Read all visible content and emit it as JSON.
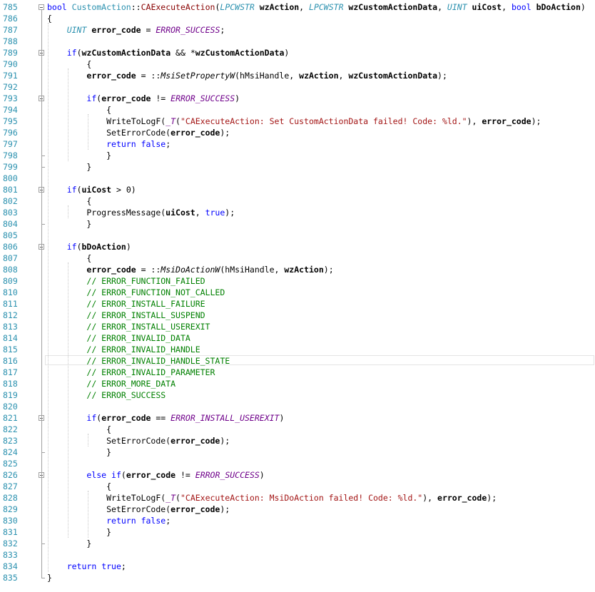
{
  "editor": {
    "lines": [
      {
        "n": "785",
        "t": [
          [
            "kw",
            "bool"
          ],
          [
            "",
            " "
          ],
          [
            "ty2",
            "CustomAction"
          ],
          [
            "",
            "::"
          ],
          [
            "fn",
            "CAExecuteAction"
          ],
          [
            "",
            "("
          ],
          [
            "ty",
            "LPCWSTR"
          ],
          [
            "",
            ""
          ],
          [
            "par",
            " wzAction"
          ],
          [
            "",
            ", "
          ],
          [
            "ty",
            "LPCWSTR"
          ],
          [
            "par",
            " wzCustomActionData"
          ],
          [
            "",
            ", "
          ],
          [
            "ty",
            "UINT"
          ],
          [
            "par",
            " uiCost"
          ],
          [
            "",
            ", "
          ],
          [
            "kw",
            "bool"
          ],
          [
            "par",
            " bDoAction"
          ],
          [
            "",
            ")"
          ]
        ]
      },
      {
        "n": "786",
        "t": [
          [
            "",
            "{"
          ]
        ]
      },
      {
        "n": "787",
        "t": [
          [
            "",
            "    "
          ],
          [
            "ty",
            "UINT"
          ],
          [
            "par",
            " error_code"
          ],
          [
            "",
            " = "
          ],
          [
            "mac",
            "ERROR_SUCCESS"
          ],
          [
            "",
            ";"
          ]
        ]
      },
      {
        "n": "788",
        "t": []
      },
      {
        "n": "789",
        "t": [
          [
            "",
            "    "
          ],
          [
            "kw",
            "if"
          ],
          [
            "",
            "("
          ],
          [
            "par",
            "wzCustomActionData"
          ],
          [
            "",
            " && *"
          ],
          [
            "par",
            "wzCustomActionData"
          ],
          [
            "",
            ")"
          ]
        ]
      },
      {
        "n": "790",
        "t": [
          [
            "",
            "        {"
          ]
        ]
      },
      {
        "n": "791",
        "t": [
          [
            "",
            "        "
          ],
          [
            "par",
            "error_code"
          ],
          [
            "",
            " = ::"
          ],
          [
            "mfn",
            "MsiSetPropertyW"
          ],
          [
            "",
            "(hMsiHandle, "
          ],
          [
            "par",
            "wzAction"
          ],
          [
            "",
            ", "
          ],
          [
            "par",
            "wzCustomActionData"
          ],
          [
            "",
            ");"
          ]
        ]
      },
      {
        "n": "792",
        "t": []
      },
      {
        "n": "793",
        "t": [
          [
            "",
            "        "
          ],
          [
            "kw",
            "if"
          ],
          [
            "",
            "("
          ],
          [
            "par",
            "error_code"
          ],
          [
            "",
            " != "
          ],
          [
            "mac",
            "ERROR_SUCCESS"
          ],
          [
            "",
            ")"
          ]
        ]
      },
      {
        "n": "794",
        "t": [
          [
            "",
            "            {"
          ]
        ]
      },
      {
        "n": "795",
        "t": [
          [
            "",
            "            WriteToLogF("
          ],
          [
            "mac",
            "_T"
          ],
          [
            "",
            "("
          ],
          [
            "str",
            "\"CAExecuteAction: Set CustomActionData failed! Code: %ld.\""
          ],
          [
            "",
            "), "
          ],
          [
            "par",
            "error_code"
          ],
          [
            "",
            ");"
          ]
        ]
      },
      {
        "n": "796",
        "t": [
          [
            "",
            "            SetErrorCode("
          ],
          [
            "par",
            "error_code"
          ],
          [
            "",
            ");"
          ]
        ]
      },
      {
        "n": "797",
        "t": [
          [
            "",
            "            "
          ],
          [
            "kw",
            "return"
          ],
          [
            "",
            " "
          ],
          [
            "kw",
            "false"
          ],
          [
            "",
            ";"
          ]
        ]
      },
      {
        "n": "798",
        "t": [
          [
            "",
            "            }"
          ]
        ]
      },
      {
        "n": "799",
        "t": [
          [
            "",
            "        }"
          ]
        ]
      },
      {
        "n": "800",
        "t": []
      },
      {
        "n": "801",
        "t": [
          [
            "",
            "    "
          ],
          [
            "kw",
            "if"
          ],
          [
            "",
            "("
          ],
          [
            "par",
            "uiCost"
          ],
          [
            "",
            " > 0)"
          ]
        ]
      },
      {
        "n": "802",
        "t": [
          [
            "",
            "        {"
          ]
        ]
      },
      {
        "n": "803",
        "t": [
          [
            "",
            "        ProgressMessage("
          ],
          [
            "par",
            "uiCost"
          ],
          [
            "",
            ", "
          ],
          [
            "kw",
            "true"
          ],
          [
            "",
            ");"
          ]
        ]
      },
      {
        "n": "804",
        "t": [
          [
            "",
            "        }"
          ]
        ]
      },
      {
        "n": "805",
        "t": []
      },
      {
        "n": "806",
        "t": [
          [
            "",
            "    "
          ],
          [
            "kw",
            "if"
          ],
          [
            "",
            "("
          ],
          [
            "par",
            "bDoAction"
          ],
          [
            "",
            ")"
          ]
        ]
      },
      {
        "n": "807",
        "t": [
          [
            "",
            "        {"
          ]
        ]
      },
      {
        "n": "808",
        "t": [
          [
            "",
            "        "
          ],
          [
            "par",
            "error_code"
          ],
          [
            "",
            " = ::"
          ],
          [
            "mfn",
            "MsiDoActionW"
          ],
          [
            "",
            "(hMsiHandle, "
          ],
          [
            "par",
            "wzAction"
          ],
          [
            "",
            ");"
          ]
        ]
      },
      {
        "n": "809",
        "t": [
          [
            "",
            "        "
          ],
          [
            "cm",
            "// ERROR_FUNCTION_FAILED"
          ]
        ]
      },
      {
        "n": "810",
        "t": [
          [
            "",
            "        "
          ],
          [
            "cm",
            "// ERROR_FUNCTION_NOT_CALLED"
          ]
        ]
      },
      {
        "n": "811",
        "t": [
          [
            "",
            "        "
          ],
          [
            "cm",
            "// ERROR_INSTALL_FAILURE"
          ]
        ]
      },
      {
        "n": "812",
        "t": [
          [
            "",
            "        "
          ],
          [
            "cm",
            "// ERROR_INSTALL_SUSPEND"
          ]
        ]
      },
      {
        "n": "813",
        "t": [
          [
            "",
            "        "
          ],
          [
            "cm",
            "// ERROR_INSTALL_USEREXIT"
          ]
        ]
      },
      {
        "n": "814",
        "t": [
          [
            "",
            "        "
          ],
          [
            "cm",
            "// ERROR_INVALID_DATA"
          ]
        ]
      },
      {
        "n": "815",
        "t": [
          [
            "",
            "        "
          ],
          [
            "cm",
            "// ERROR_INVALID_HANDLE"
          ]
        ]
      },
      {
        "n": "816",
        "t": [
          [
            "",
            "        "
          ],
          [
            "cm",
            "// ERROR_INVALID_HANDLE_STATE"
          ]
        ]
      },
      {
        "n": "817",
        "t": [
          [
            "",
            "        "
          ],
          [
            "cm",
            "// ERROR_INVALID_PARAMETER"
          ]
        ]
      },
      {
        "n": "818",
        "t": [
          [
            "",
            "        "
          ],
          [
            "cm",
            "// ERROR_MORE_DATA"
          ]
        ]
      },
      {
        "n": "819",
        "t": [
          [
            "",
            "        "
          ],
          [
            "cm",
            "// ERROR_SUCCESS"
          ]
        ]
      },
      {
        "n": "820",
        "t": []
      },
      {
        "n": "821",
        "t": [
          [
            "",
            "        "
          ],
          [
            "kw",
            "if"
          ],
          [
            "",
            "("
          ],
          [
            "par",
            "error_code"
          ],
          [
            "",
            " == "
          ],
          [
            "mac",
            "ERROR_INSTALL_USEREXIT"
          ],
          [
            "",
            ")"
          ]
        ]
      },
      {
        "n": "822",
        "t": [
          [
            "",
            "            {"
          ]
        ]
      },
      {
        "n": "823",
        "t": [
          [
            "",
            "            SetErrorCode("
          ],
          [
            "par",
            "error_code"
          ],
          [
            "",
            ");"
          ]
        ]
      },
      {
        "n": "824",
        "t": [
          [
            "",
            "            }"
          ]
        ]
      },
      {
        "n": "825",
        "t": []
      },
      {
        "n": "826",
        "t": [
          [
            "",
            "        "
          ],
          [
            "kw",
            "else"
          ],
          [
            "",
            " "
          ],
          [
            "kw",
            "if"
          ],
          [
            "",
            "("
          ],
          [
            "par",
            "error_code"
          ],
          [
            "",
            " != "
          ],
          [
            "mac",
            "ERROR_SUCCESS"
          ],
          [
            "",
            ")"
          ]
        ]
      },
      {
        "n": "827",
        "t": [
          [
            "",
            "            {"
          ]
        ]
      },
      {
        "n": "828",
        "t": [
          [
            "",
            "            WriteToLogF("
          ],
          [
            "mac",
            "_T"
          ],
          [
            "",
            "("
          ],
          [
            "str",
            "\"CAExecuteAction: MsiDoAction failed! Code: %ld.\""
          ],
          [
            "",
            "), "
          ],
          [
            "par",
            "error_code"
          ],
          [
            "",
            ");"
          ]
        ]
      },
      {
        "n": "829",
        "t": [
          [
            "",
            "            SetErrorCode("
          ],
          [
            "par",
            "error_code"
          ],
          [
            "",
            ");"
          ]
        ]
      },
      {
        "n": "830",
        "t": [
          [
            "",
            "            "
          ],
          [
            "kw",
            "return"
          ],
          [
            "",
            " "
          ],
          [
            "kw",
            "false"
          ],
          [
            "",
            ";"
          ]
        ]
      },
      {
        "n": "831",
        "t": [
          [
            "",
            "            }"
          ]
        ]
      },
      {
        "n": "832",
        "t": [
          [
            "",
            "        }"
          ]
        ]
      },
      {
        "n": "833",
        "t": []
      },
      {
        "n": "834",
        "t": [
          [
            "",
            "    "
          ],
          [
            "kw",
            "return"
          ],
          [
            "",
            " "
          ],
          [
            "kw",
            "true"
          ],
          [
            "",
            ";"
          ]
        ]
      },
      {
        "n": "835",
        "t": [
          [
            "",
            "}"
          ]
        ]
      }
    ],
    "collapse_markers": [
      "785",
      "789",
      "793",
      "801",
      "806",
      "821",
      "826"
    ],
    "current_line": "816"
  }
}
